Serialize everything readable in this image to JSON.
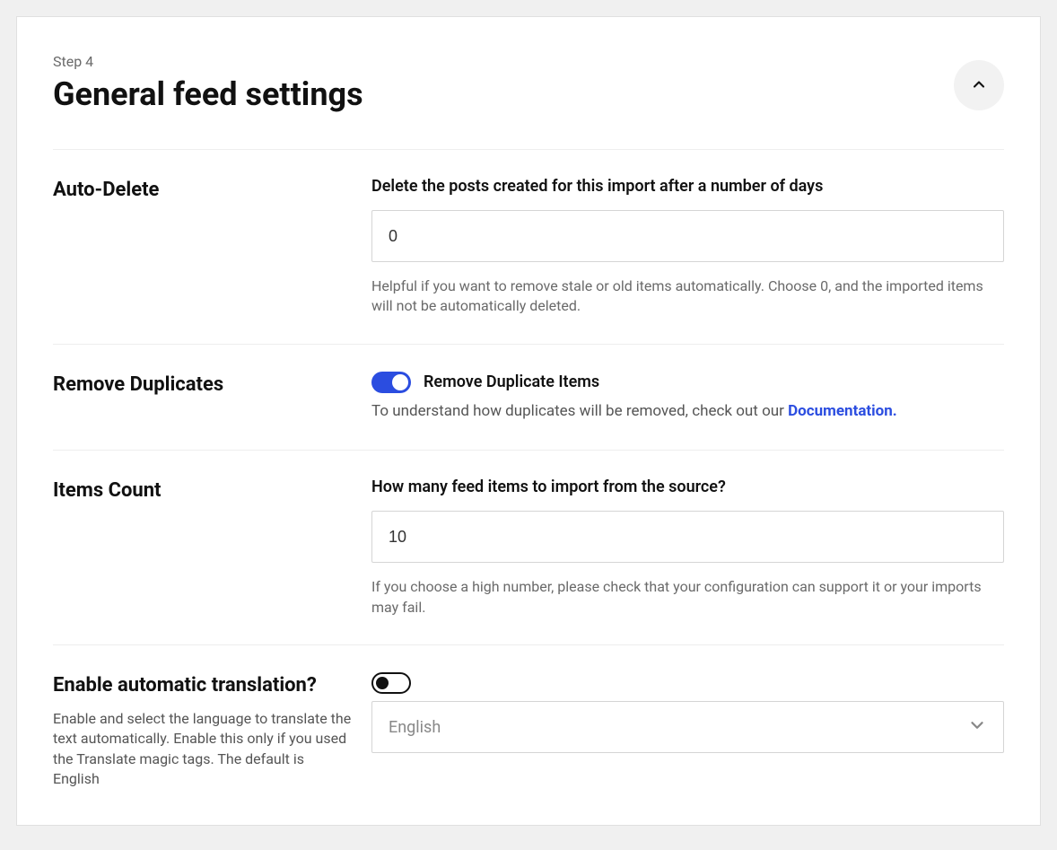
{
  "header": {
    "step": "Step 4",
    "title": "General feed settings"
  },
  "auto_delete": {
    "section_label": "Auto-Delete",
    "field_label": "Delete the posts created for this import after a number of days",
    "value": "0",
    "help": "Helpful if you want to remove stale or old items automatically. Choose 0, and the imported items will not be automatically deleted."
  },
  "remove_duplicates": {
    "section_label": "Remove Duplicates",
    "toggle_on": true,
    "toggle_label": "Remove Duplicate Items",
    "help_prefix": "To understand how duplicates will be removed, check out our ",
    "link_text": "Documentation."
  },
  "items_count": {
    "section_label": "Items Count",
    "field_label": "How many feed items to import from the source?",
    "value": "10",
    "help": "If you choose a high number, please check that your configuration can support it or your imports may fail."
  },
  "translation": {
    "section_label": "Enable automatic translation?",
    "section_desc": "Enable and select the language to translate the text automatically. Enable this only if you used the Translate magic tags. The default is English",
    "toggle_on": false,
    "selected_language": "English"
  }
}
